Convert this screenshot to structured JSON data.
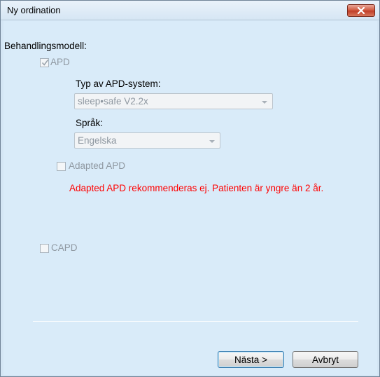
{
  "window": {
    "title": "Ny ordination",
    "close_icon": "close-x-icon"
  },
  "form": {
    "model_label": "Behandlingsmodell:",
    "apd": {
      "label": "APD",
      "checked": true,
      "enabled": false
    },
    "apd_system": {
      "label": "Typ av APD-system:",
      "value": "sleep•safe V2.2x"
    },
    "language": {
      "label": "Språk:",
      "value": "Engelska"
    },
    "adapted_apd": {
      "label": "Adapted APD",
      "checked": false,
      "enabled": false
    },
    "warning": "Adapted APD rekommenderas ej. Patienten är yngre än 2 år.",
    "capd": {
      "label": "CAPD",
      "checked": false,
      "enabled": false
    }
  },
  "buttons": {
    "next": "Nästa >",
    "cancel": "Avbryt"
  },
  "colors": {
    "background": "#d9ebf9",
    "warning": "#ff0000",
    "disabled_text": "#8f98a1"
  }
}
